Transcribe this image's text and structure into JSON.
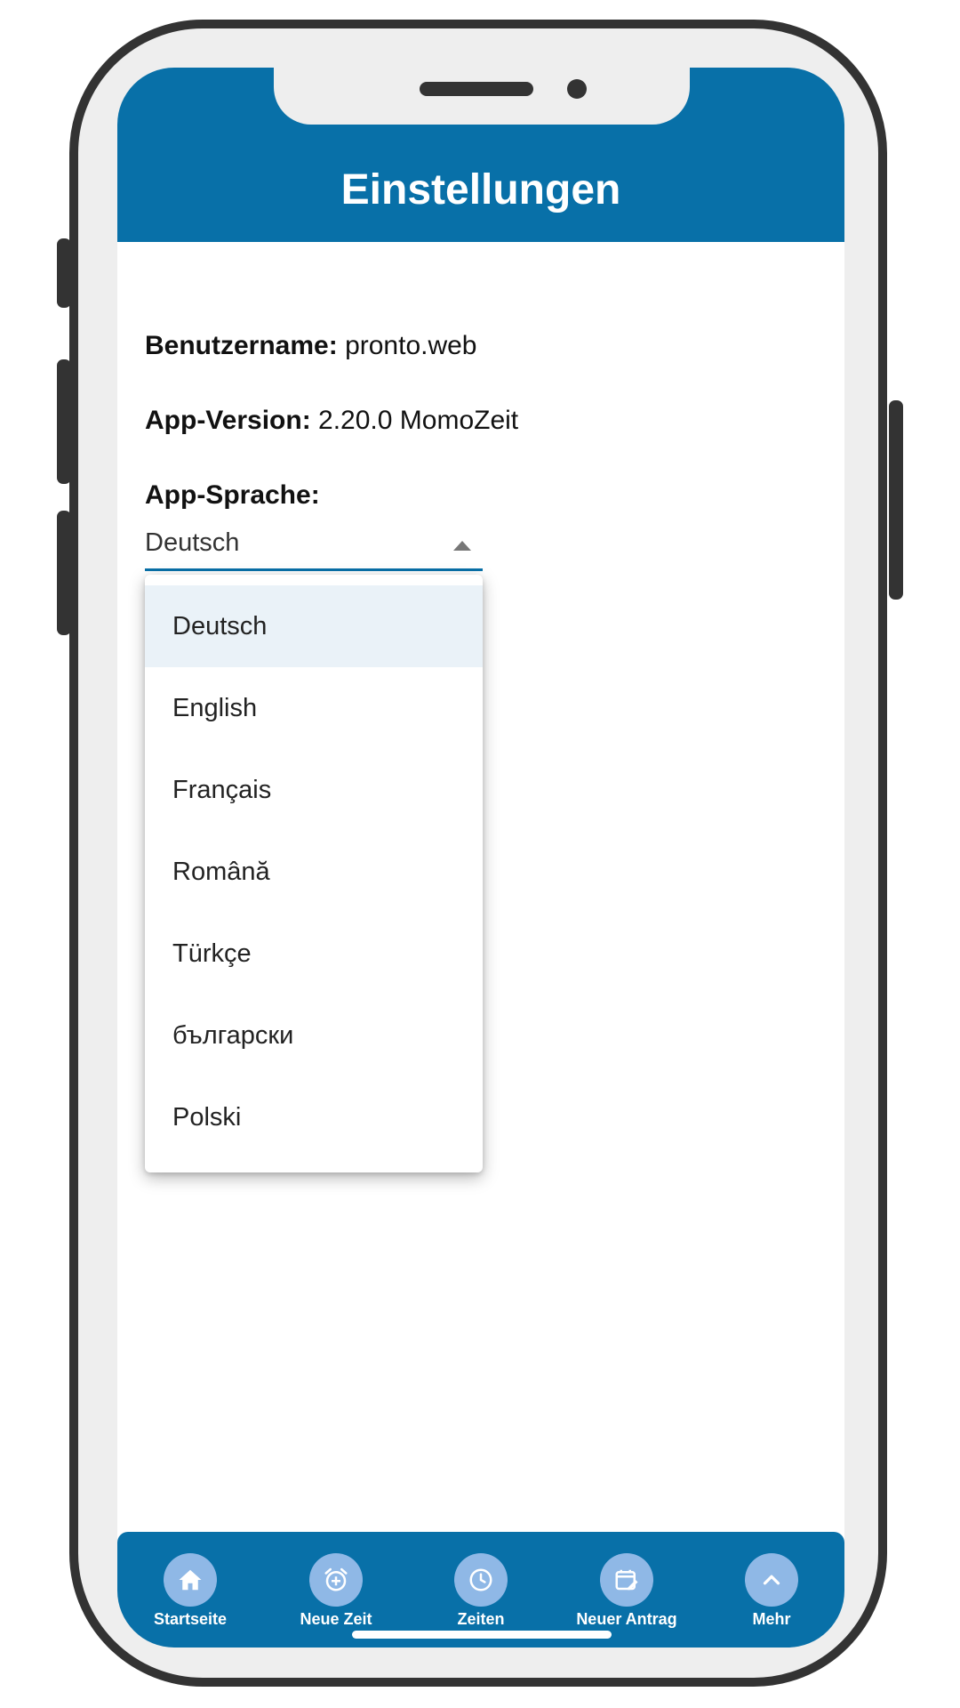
{
  "header": {
    "title": "Einstellungen"
  },
  "info": {
    "username_label": "Benutzername:",
    "username_value": "pronto.web",
    "version_label": "App-Version:",
    "version_value": "2.20.0 MomoZeit",
    "language_label": "App-Sprache:"
  },
  "language_select": {
    "selected": "Deutsch",
    "options": [
      "Deutsch",
      "English",
      "Français",
      "Română",
      "Türkçe",
      "български",
      "Polski"
    ]
  },
  "bottom_nav": {
    "items": [
      {
        "label": "Startseite",
        "icon": "home-icon"
      },
      {
        "label": "Neue Zeit",
        "icon": "alarm-add-icon"
      },
      {
        "label": "Zeiten",
        "icon": "clock-icon"
      },
      {
        "label": "Neuer Antrag",
        "icon": "calendar-edit-icon"
      },
      {
        "label": "Mehr",
        "icon": "chevron-up-icon"
      }
    ]
  },
  "colors": {
    "primary": "#0870a8",
    "nav_icon_bg": "#8fb8e6",
    "selected_option_bg": "#eaf2f8",
    "phone_frame": "#333333"
  }
}
